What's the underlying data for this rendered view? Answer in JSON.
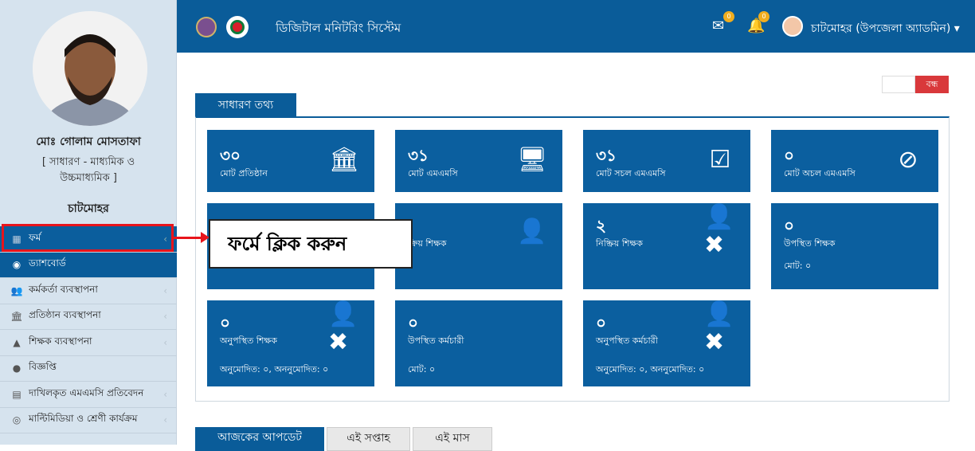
{
  "sidebar": {
    "profile_name": "মোঃ গোলাম মোসতাফা",
    "profile_role": "[ সাধারণ - মাধ্যমিক ও উচ্চমাধ্যমিক ]",
    "upazila": "চাটমোহর",
    "menu": [
      {
        "label": "ফর্ম",
        "icon": "form-icon"
      },
      {
        "label": "ড্যাশবোর্ড",
        "icon": "dashboard-icon"
      },
      {
        "label": "কর্মকর্তা ব্যবস্থাপনা",
        "icon": "users-icon"
      },
      {
        "label": "প্রতিষ্ঠান ব্যবস্থাপনা",
        "icon": "institution-icon"
      },
      {
        "label": "শিক্ষক ব্যবস্থাপনা",
        "icon": "teacher-icon"
      },
      {
        "label": "বিজ্ঞপ্তি",
        "icon": "comment-icon"
      },
      {
        "label": "দাখিলকৃত এমএমসি প্রতিবেদন",
        "icon": "id-card-icon"
      },
      {
        "label": "মাল্টিমিডিয়া ও শ্রেণী কার্যক্রম",
        "icon": "target-icon"
      }
    ]
  },
  "topbar": {
    "title": "ডিজিটাল মনিটরিং সিস্টেম",
    "mail_count": "0",
    "notify_count": "0",
    "user": "চাটমোহর (উপজেলা অ্যাডমিন)",
    "caret": "▾"
  },
  "toggle": {
    "on_label": "বন্ধ"
  },
  "panel": {
    "tab_label": "সাধারণ তথ্য"
  },
  "cards": [
    {
      "num": "৩০",
      "label": "মোট প্রতিষ্ঠান",
      "sub": "",
      "icon": "bank-icon",
      "glyph": "🏛"
    },
    {
      "num": "৩১",
      "label": "মোট এমএমসি",
      "sub": "",
      "icon": "monitor-icon",
      "glyph": "🖥"
    },
    {
      "num": "৩১",
      "label": "মোট সচল এমএমসি",
      "sub": "",
      "icon": "checkbox-icon",
      "glyph": "☑"
    },
    {
      "num": "০",
      "label": "মোট অচল এমএমসি",
      "sub": "",
      "icon": "ban-icon",
      "glyph": "⊘"
    },
    {
      "num": "",
      "label": "",
      "sub": "",
      "icon": "",
      "glyph": ""
    },
    {
      "num": "",
      "label": "ক্রিয় শিক্ষক",
      "sub": "",
      "icon": "user-icon",
      "glyph": "👤"
    },
    {
      "num": "২",
      "label": "নিষ্ক্রিয় শিক্ষক",
      "sub": "",
      "icon": "user-x-icon",
      "glyph": "👤✖"
    },
    {
      "num": "০",
      "label": "উপস্থিত শিক্ষক",
      "sub": "মোট: ০",
      "icon": "",
      "glyph": ""
    },
    {
      "num": "০",
      "label": "অনুপস্থিত শিক্ষক",
      "sub": "অনুমোদিত: ০, অননুমোদিত: ০",
      "icon": "user-x-icon",
      "glyph": "👤✖"
    },
    {
      "num": "০",
      "label": "উপস্থিত কর্মচারী",
      "sub": "মোট: ০",
      "icon": "",
      "glyph": ""
    },
    {
      "num": "০",
      "label": "অনুপস্থিত কর্মচারী",
      "sub": "অনুমোদিত: ০, অননুমোদিত: ০",
      "icon": "user-x-icon",
      "glyph": "👤✖"
    }
  ],
  "callout": {
    "text": "ফর্মে ক্লিক করুন"
  },
  "bottom_tabs": [
    "আজকের আপডেট",
    "এই সপ্তাহ",
    "এই মাস"
  ]
}
